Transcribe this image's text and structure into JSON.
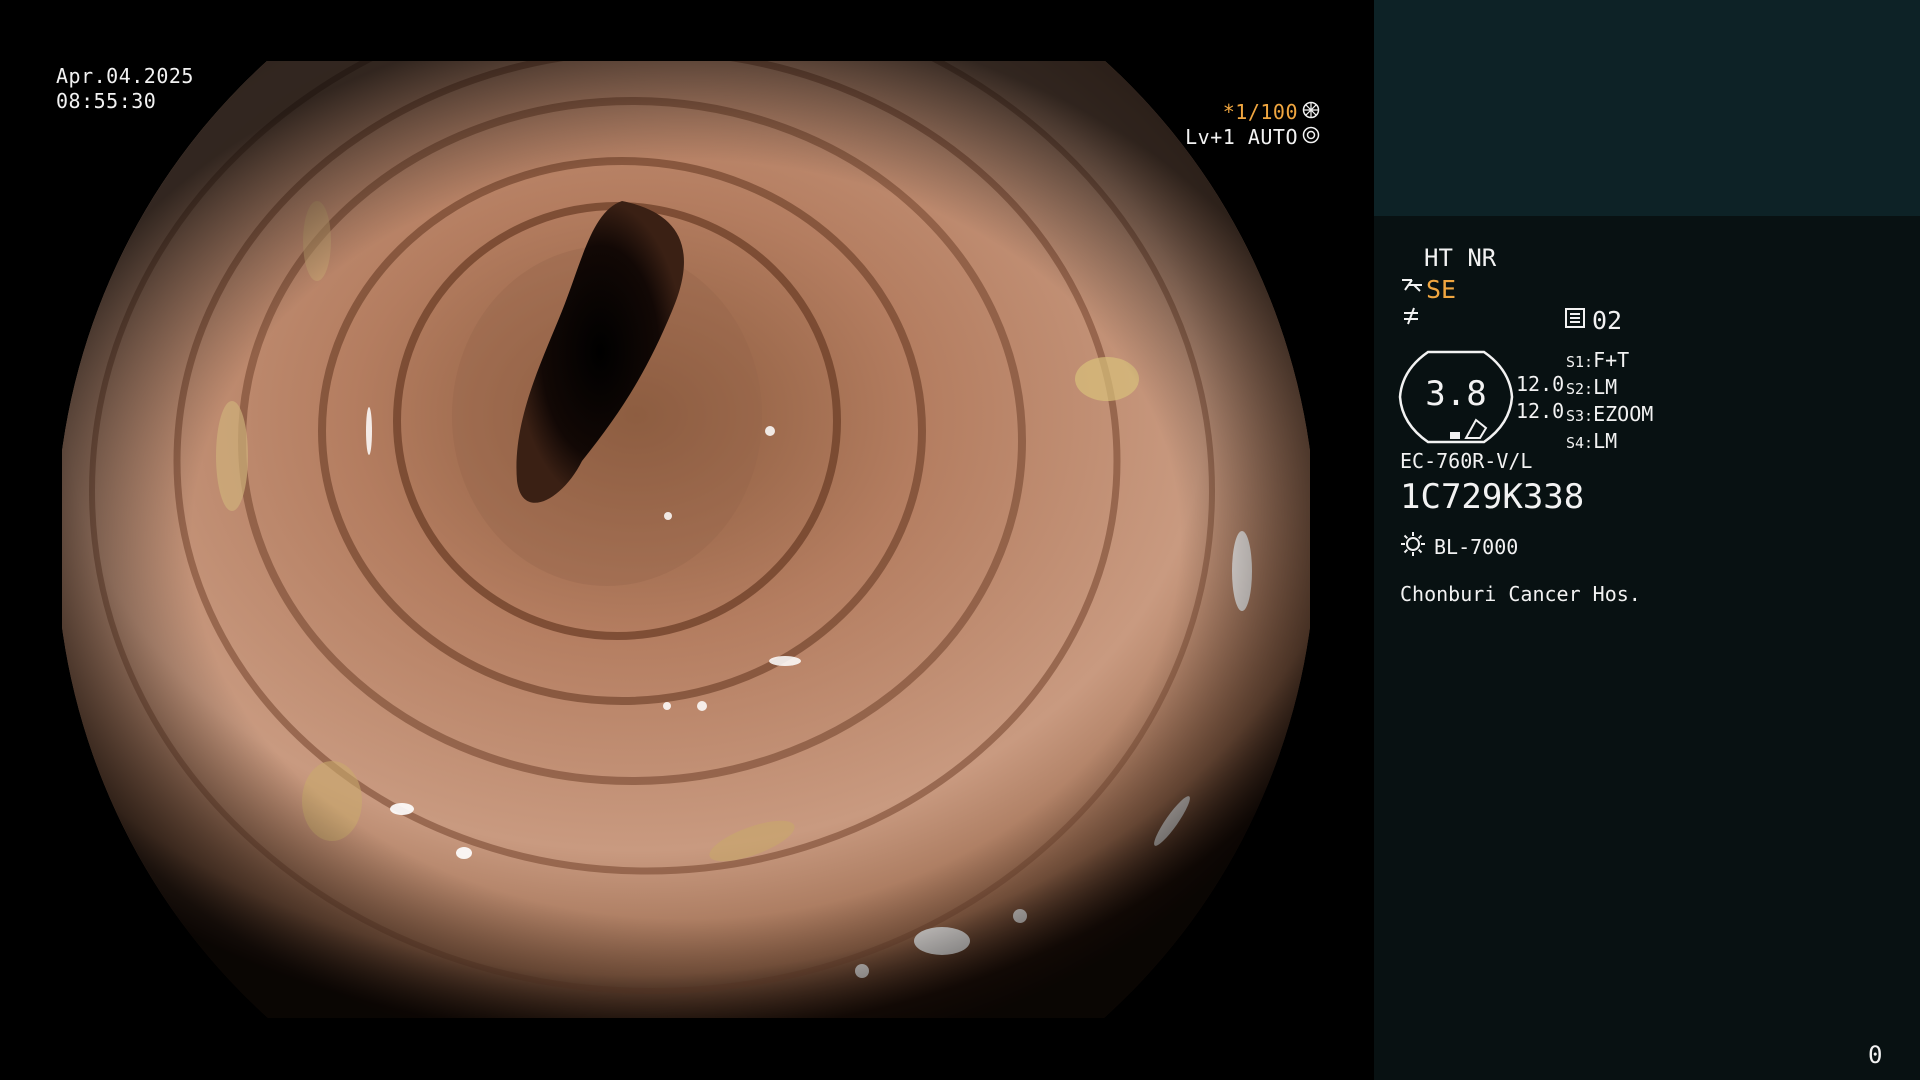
{
  "overlay": {
    "date": "Apr.04.2025",
    "time": "08:55:30",
    "shutter": "*1/100",
    "level": "Lv+1 AUTO"
  },
  "panel": {
    "mode": "HT NR",
    "structure_enhancement": "SE",
    "preset": "02",
    "zoom_value": "3.8",
    "gain_values": [
      "12.0",
      "12.0"
    ],
    "switches": [
      {
        "key": "S1:",
        "value": "F+T"
      },
      {
        "key": "S2:",
        "value": "LM"
      },
      {
        "key": "S3:",
        "value": "EZOOM"
      },
      {
        "key": "S4:",
        "value": "LM"
      }
    ],
    "scope_model": "EC-760R-V/L",
    "scope_serial": "1C729K338",
    "light_source": "BL-7000",
    "institution": "Chonburi Cancer Hos.",
    "counter": "0"
  },
  "colors": {
    "panel_top": "#0d2226",
    "panel_bottom": "#081112",
    "accent_orange": "#f0a640",
    "text": "#f2f2f2"
  },
  "icons": [
    "shutter-aperture-icon",
    "auto-iris-icon",
    "structure-enhance-icon",
    "edge-enhance-icon",
    "memory-card-icon",
    "light-source-icon"
  ]
}
